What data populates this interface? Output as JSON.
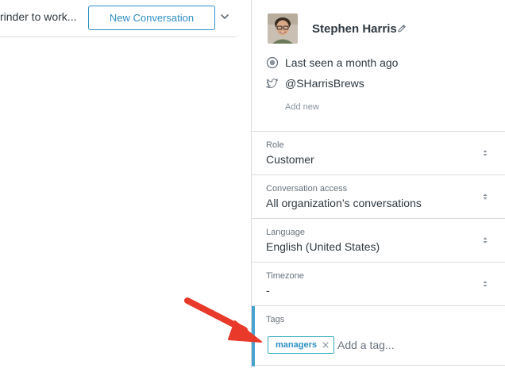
{
  "header": {
    "subject": "rinder to work...",
    "new_conversation_label": "New Conversation"
  },
  "user": {
    "name": "Stephen Harris",
    "last_seen": "Last seen a month ago",
    "twitter_handle": "@SHarrisBrews",
    "add_new_label": "Add new"
  },
  "fields": {
    "role": {
      "label": "Role",
      "value": "Customer"
    },
    "conversation_access": {
      "label": "Conversation access",
      "value": "All organization’s conversations"
    },
    "language": {
      "label": "Language",
      "value": "English (United States)"
    },
    "timezone": {
      "label": "Timezone",
      "value": "-"
    }
  },
  "tags": {
    "label": "Tags",
    "items": [
      "managers"
    ],
    "input_placeholder": "Add a tag..."
  },
  "colors": {
    "accent_blue": "#2e8fc6",
    "tag_border": "#30aabc",
    "active_bar": "#4aa3cf",
    "annotation_arrow": "#e8392a"
  },
  "icons": {
    "chevron": "chevron-down-icon",
    "edit": "pencil-icon",
    "status": "status-circle-icon",
    "social": "twitter-icon",
    "select": "select-arrows-icon",
    "remove": "close-icon"
  }
}
